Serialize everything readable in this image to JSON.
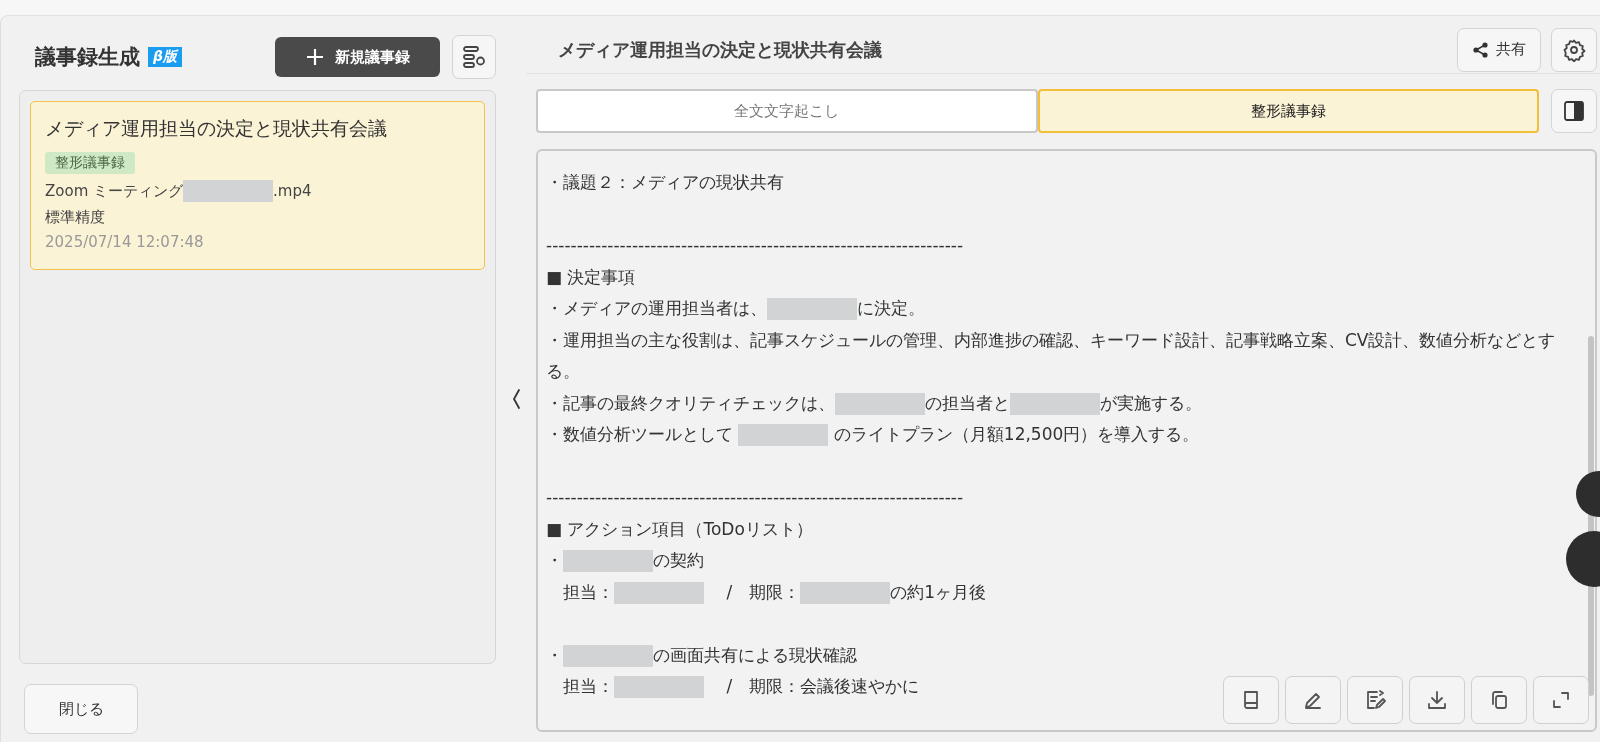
{
  "sidebar": {
    "title": "議事録生成",
    "badge": "β版",
    "new_button": "新規議事録",
    "items": [
      {
        "title": "メディア運用担当の決定と現状共有会議",
        "tag": "整形議事録",
        "file": [
          {
            "kind": "text",
            "text": "Zoom ミーティング "
          },
          {
            "kind": "redacted"
          },
          {
            "kind": "text",
            "text": ".mp4"
          }
        ],
        "precision": "標準精度",
        "date": "2025/07/14 12:07:48",
        "selected": true
      }
    ],
    "close_button": "閉じる"
  },
  "main": {
    "title": "メディア運用担当の決定と現状共有会議",
    "share_button": "共有",
    "tabs": [
      {
        "label": "全文文字起こし",
        "selected": false
      },
      {
        "label": "整形議事録",
        "selected": true
      }
    ],
    "lines": [
      {
        "parts": [
          {
            "kind": "text",
            "text": "・議題２：メディアの現状共有"
          }
        ]
      },
      {
        "kind": "blank"
      },
      {
        "parts": [
          {
            "kind": "text",
            "text": "--------------------------------------------------------------------"
          }
        ]
      },
      {
        "parts": [
          {
            "kind": "text",
            "text": "■ 決定事項"
          }
        ]
      },
      {
        "parts": [
          {
            "kind": "text",
            "text": "・メディアの運用担当者は、"
          },
          {
            "kind": "redacted"
          },
          {
            "kind": "text",
            "text": "に決定。"
          }
        ]
      },
      {
        "parts": [
          {
            "kind": "text",
            "text": "・運用担当の主な役割は、記事スケジュールの管理、内部進捗の確認、キーワード設計、記事戦略立案、CV設計、数値分析などとする。"
          }
        ]
      },
      {
        "parts": [
          {
            "kind": "text",
            "text": "・記事の最終クオリティチェックは、"
          },
          {
            "kind": "redacted"
          },
          {
            "kind": "text",
            "text": "の担当者と"
          },
          {
            "kind": "redacted"
          },
          {
            "kind": "text",
            "text": "が実施する。"
          }
        ]
      },
      {
        "parts": [
          {
            "kind": "text",
            "text": "・数値分析ツールとして "
          },
          {
            "kind": "redacted"
          },
          {
            "kind": "text",
            "text": " のライトプラン（月額12,500円）を導入する。"
          }
        ]
      },
      {
        "kind": "blank"
      },
      {
        "parts": [
          {
            "kind": "text",
            "text": "--------------------------------------------------------------------"
          }
        ]
      },
      {
        "parts": [
          {
            "kind": "text",
            "text": "■ アクション項目（ToDoリスト）"
          }
        ]
      },
      {
        "parts": [
          {
            "kind": "text",
            "text": "・"
          },
          {
            "kind": "redacted"
          },
          {
            "kind": "text",
            "text": "の契約"
          }
        ]
      },
      {
        "parts": [
          {
            "kind": "text",
            "text": "　担当："
          },
          {
            "kind": "redacted"
          },
          {
            "kind": "text",
            "text": " 　/　期限："
          },
          {
            "kind": "redacted"
          },
          {
            "kind": "text",
            "text": "の約1ヶ月後"
          }
        ]
      },
      {
        "kind": "blank"
      },
      {
        "parts": [
          {
            "kind": "text",
            "text": "・"
          },
          {
            "kind": "redacted"
          },
          {
            "kind": "text",
            "text": "の画面共有による現状確認"
          }
        ]
      },
      {
        "parts": [
          {
            "kind": "text",
            "text": "　担当："
          },
          {
            "kind": "redacted"
          },
          {
            "kind": "text",
            "text": " 　/　期限：会議後速やかに"
          }
        ]
      }
    ]
  }
}
